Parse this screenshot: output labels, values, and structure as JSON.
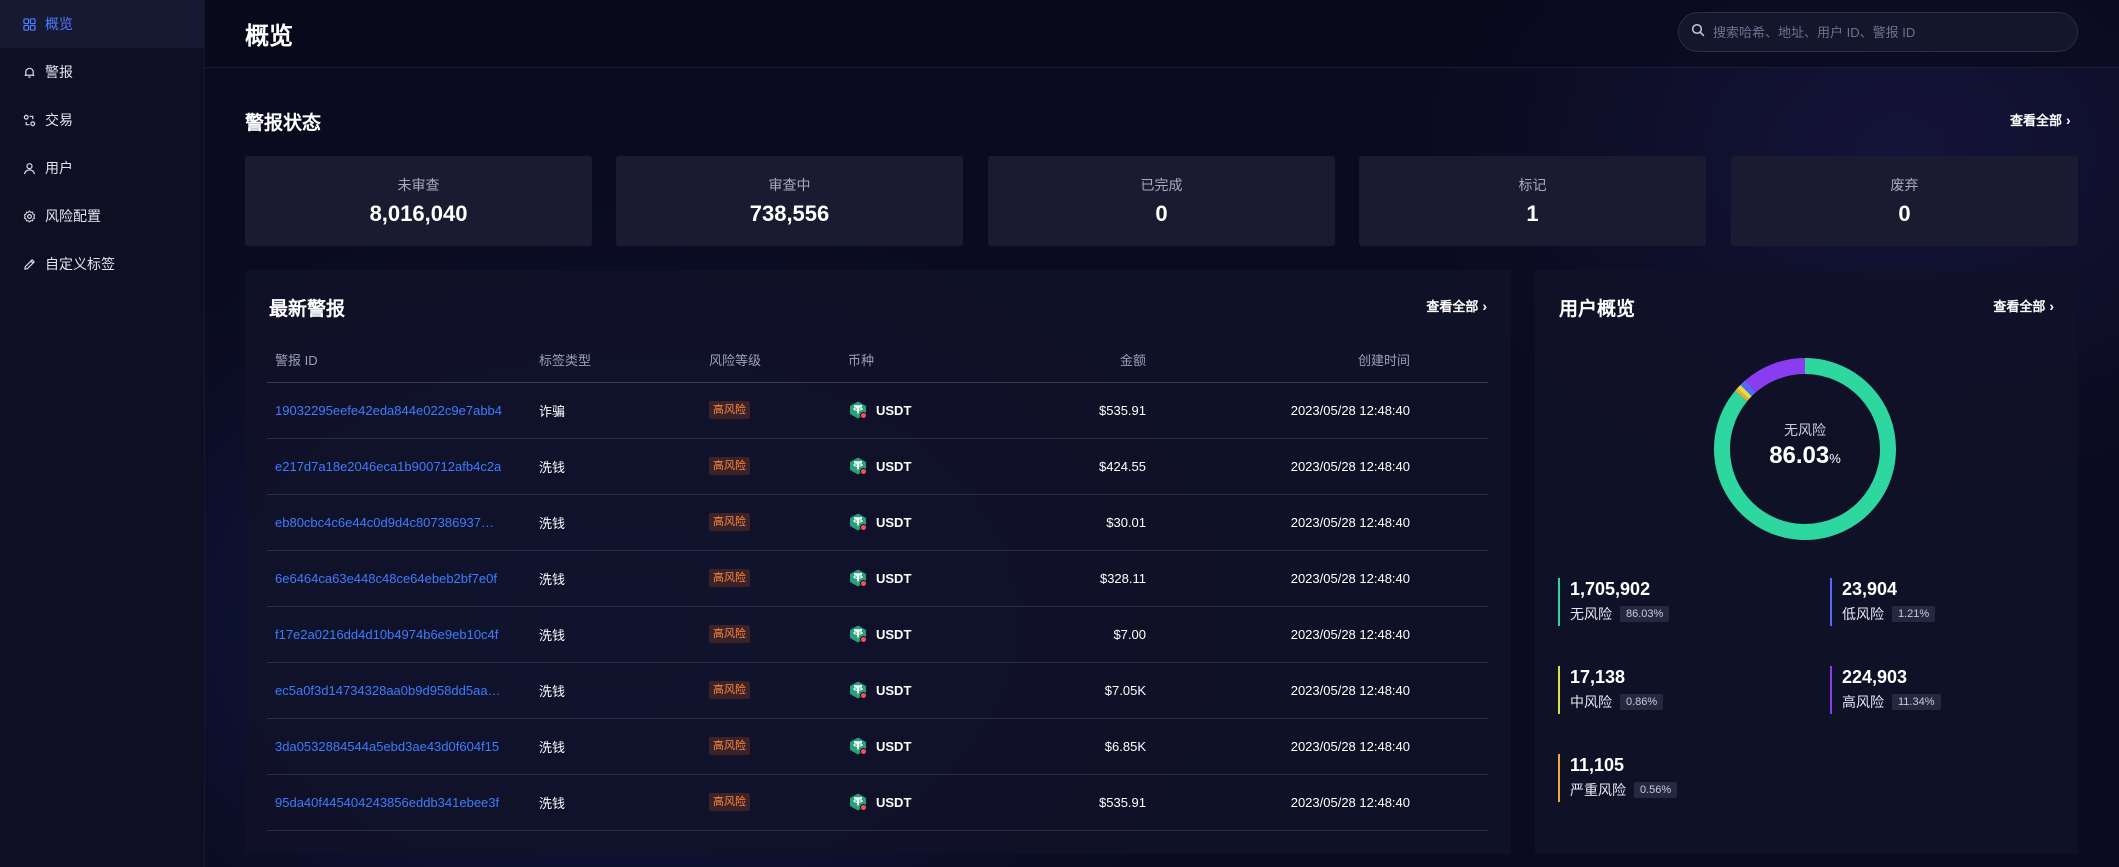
{
  "sidebar": {
    "items": [
      {
        "label": "概览",
        "icon": "grid-icon",
        "active": true
      },
      {
        "label": "警报",
        "icon": "bell-icon"
      },
      {
        "label": "交易",
        "icon": "transaction-icon"
      },
      {
        "label": "用户",
        "icon": "user-icon"
      },
      {
        "label": "风险配置",
        "icon": "gear-icon"
      },
      {
        "label": "自定义标签",
        "icon": "pencil-icon"
      }
    ]
  },
  "header": {
    "title": "概览",
    "search_placeholder": "搜索哈希、地址、用户 ID、警报 ID"
  },
  "alert_status": {
    "title": "警报状态",
    "view_all": "查看全部",
    "cards": [
      {
        "label": "未审查",
        "value": "8,016,040"
      },
      {
        "label": "审查中",
        "value": "738,556"
      },
      {
        "label": "已完成",
        "value": "0"
      },
      {
        "label": "标记",
        "value": "1"
      },
      {
        "label": "废弃",
        "value": "0"
      }
    ]
  },
  "latest_alerts": {
    "title": "最新警报",
    "view_all": "查看全部",
    "columns": {
      "id": "警报 ID",
      "tag": "标签类型",
      "risk": "风险等级",
      "coin": "币种",
      "amount": "金额",
      "time": "创建时间"
    },
    "rows": [
      {
        "id": "19032295eefe42eda844e022c9e7abb4",
        "tag": "诈骗",
        "risk": "高风险",
        "coin": "USDT",
        "amount": "$535.91",
        "time": "2023/05/28 12:48:40"
      },
      {
        "id": "e217d7a18e2046eca1b900712afb4c2a",
        "tag": "洗钱",
        "risk": "高风险",
        "coin": "USDT",
        "amount": "$424.55",
        "time": "2023/05/28 12:48:40"
      },
      {
        "id": "eb80cbc4c6e44c0d9d4c807386937…",
        "tag": "洗钱",
        "risk": "高风险",
        "coin": "USDT",
        "amount": "$30.01",
        "time": "2023/05/28 12:48:40"
      },
      {
        "id": "6e6464ca63e448c48ce64ebeb2bf7e0f",
        "tag": "洗钱",
        "risk": "高风险",
        "coin": "USDT",
        "amount": "$328.11",
        "time": "2023/05/28 12:48:40"
      },
      {
        "id": "f17e2a0216dd4d10b4974b6e9eb10c4f",
        "tag": "洗钱",
        "risk": "高风险",
        "coin": "USDT",
        "amount": "$7.00",
        "time": "2023/05/28 12:48:40"
      },
      {
        "id": "ec5a0f3d14734328aa0b9d958dd5aa…",
        "tag": "洗钱",
        "risk": "高风险",
        "coin": "USDT",
        "amount": "$7.05K",
        "time": "2023/05/28 12:48:40"
      },
      {
        "id": "3da0532884544a5ebd3ae43d0f604f15",
        "tag": "洗钱",
        "risk": "高风险",
        "coin": "USDT",
        "amount": "$6.85K",
        "time": "2023/05/28 12:48:40"
      },
      {
        "id": "95da40f445404243856eddb341ebee3f",
        "tag": "洗钱",
        "risk": "高风险",
        "coin": "USDT",
        "amount": "$535.91",
        "time": "2023/05/28 12:48:40"
      }
    ]
  },
  "user_overview": {
    "title": "用户概览",
    "view_all": "查看全部",
    "donut_label": "无风险",
    "donut_value": "86.03",
    "donut_unit": "%",
    "segments": [
      {
        "name": "无风险",
        "count": "1,705,902",
        "pct": "86.03%",
        "value": 86.03,
        "color": "#2ed6a0"
      },
      {
        "name": "低风险",
        "count": "23,904",
        "pct": "1.21%",
        "value": 1.21,
        "color": "#5468ff"
      },
      {
        "name": "中风险",
        "count": "17,138",
        "pct": "0.86%",
        "value": 0.86,
        "color": "#d6e24a"
      },
      {
        "name": "高风险",
        "count": "224,903",
        "pct": "11.34%",
        "value": 11.34,
        "color": "#8a3cf0"
      },
      {
        "name": "严重风险",
        "count": "11,105",
        "pct": "0.56%",
        "value": 0.56,
        "color": "#f2a93b"
      }
    ]
  }
}
